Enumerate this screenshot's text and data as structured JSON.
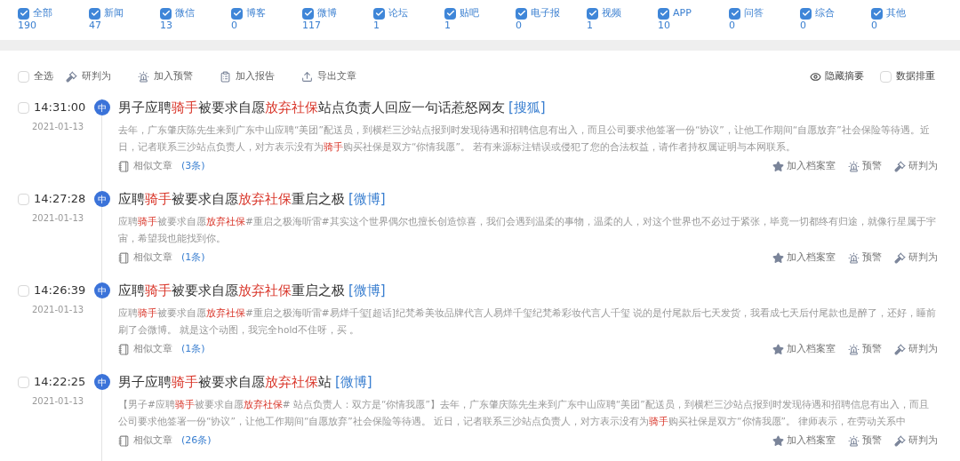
{
  "filters": [
    {
      "label": "全部",
      "count": "190",
      "checked": true
    },
    {
      "label": "新闻",
      "count": "47",
      "checked": true
    },
    {
      "label": "微信",
      "count": "13",
      "checked": true
    },
    {
      "label": "博客",
      "count": "0",
      "checked": true
    },
    {
      "label": "微博",
      "count": "117",
      "checked": true
    },
    {
      "label": "论坛",
      "count": "1",
      "checked": true
    },
    {
      "label": "贴吧",
      "count": "1",
      "checked": true
    },
    {
      "label": "电子报",
      "count": "0",
      "checked": true
    },
    {
      "label": "视频",
      "count": "1",
      "checked": true
    },
    {
      "label": "APP",
      "count": "10",
      "checked": true
    },
    {
      "label": "问答",
      "count": "0",
      "checked": true
    },
    {
      "label": "综合",
      "count": "0",
      "checked": true
    },
    {
      "label": "其他",
      "count": "0",
      "checked": true
    }
  ],
  "toolbar": {
    "select_all": {
      "label": "全选",
      "checked": false
    },
    "actions": [
      {
        "kind": "judge",
        "label": "研判为"
      },
      {
        "kind": "alert",
        "label": "加入预警"
      },
      {
        "kind": "report",
        "label": "加入报告"
      },
      {
        "kind": "export",
        "label": "导出文章"
      }
    ],
    "hide_summary": {
      "label": "隐藏摘要"
    },
    "dedupe": {
      "label": "数据排重",
      "checked": false
    }
  },
  "articles": [
    {
      "checked": false,
      "time": "14:31:00",
      "date": "2021-01-13",
      "badge": "中",
      "title": [
        {
          "text": "男子应聘",
          "highlight": false
        },
        {
          "text": "骑手",
          "highlight": true
        },
        {
          "text": "被要求自愿",
          "highlight": false
        },
        {
          "text": "放弃社保",
          "highlight": true
        },
        {
          "text": "站点负责人回应一句话惹怒网友",
          "highlight": false
        }
      ],
      "source": "[搜狐]",
      "summary": [
        {
          "text": "去年，广东肇庆陈先生来到广东中山应聘“美团”配送员，到横栏三沙站点报到时发现待遇和招聘信息有出入，而且公司要求他签署一份“协议”，让他工作期间“自愿放弃”社会保险等待遇。近日，记者联系三沙站点负责人，对方表示没有为",
          "highlight": false
        },
        {
          "text": "骑手",
          "highlight": true
        },
        {
          "text": "购买社保是双方“你情我愿”。 若有来源标注错误或侵犯了您的合法权益，请作者持权属证明与本网联系。",
          "highlight": false
        }
      ],
      "similar_label": "相似文章",
      "similar_count": "(3条)",
      "actions": [
        {
          "kind": "archive",
          "label": "加入档案室"
        },
        {
          "kind": "alert",
          "label": "预警"
        },
        {
          "kind": "judge",
          "label": "研判为"
        }
      ]
    },
    {
      "checked": false,
      "time": "14:27:28",
      "date": "2021-01-13",
      "badge": "中",
      "title": [
        {
          "text": "应聘",
          "highlight": false
        },
        {
          "text": "骑手",
          "highlight": true
        },
        {
          "text": "被要求自愿",
          "highlight": false
        },
        {
          "text": "放弃社保",
          "highlight": true
        },
        {
          "text": "重启之极",
          "highlight": false
        }
      ],
      "source": "[微博]",
      "summary": [
        {
          "text": "应聘",
          "highlight": false
        },
        {
          "text": "骑手",
          "highlight": true
        },
        {
          "text": "被要求自愿",
          "highlight": false
        },
        {
          "text": "放弃社保",
          "highlight": true
        },
        {
          "text": "#重启之极海听雷#其实这个世界偶尔也擅长创造惊喜，我们会遇到温柔的事物，温柔的人，对这个世界也不必过于紧张，毕竟一切都终有归途，就像行星属于宇宙，希望我也能找到你。",
          "highlight": false
        }
      ],
      "similar_label": "相似文章",
      "similar_count": "(1条)",
      "actions": [
        {
          "kind": "archive",
          "label": "加入档案室"
        },
        {
          "kind": "alert",
          "label": "预警"
        },
        {
          "kind": "judge",
          "label": "研判为"
        }
      ]
    },
    {
      "checked": false,
      "time": "14:26:39",
      "date": "2021-01-13",
      "badge": "中",
      "title": [
        {
          "text": "应聘",
          "highlight": false
        },
        {
          "text": "骑手",
          "highlight": true
        },
        {
          "text": "被要求自愿",
          "highlight": false
        },
        {
          "text": "放弃社保",
          "highlight": true
        },
        {
          "text": "重启之极",
          "highlight": false
        }
      ],
      "source": "[微博]",
      "summary": [
        {
          "text": "应聘",
          "highlight": false
        },
        {
          "text": "骑手",
          "highlight": true
        },
        {
          "text": "被要求自愿",
          "highlight": false
        },
        {
          "text": "放弃社保",
          "highlight": true
        },
        {
          "text": "#重启之极海听雷#易烊千玺[超话]纪梵希美妆品牌代言人易烊千玺纪梵希彩妆代言人千玺 说的是付尾款后七天发货，我看成七天后付尾款也是醉了，还好，睡前刷了会微博。 就是这个动图，我完全hold不住呀，买 。",
          "highlight": false
        }
      ],
      "similar_label": "相似文章",
      "similar_count": "(1条)",
      "actions": [
        {
          "kind": "archive",
          "label": "加入档案室"
        },
        {
          "kind": "alert",
          "label": "预警"
        },
        {
          "kind": "judge",
          "label": "研判为"
        }
      ]
    },
    {
      "checked": false,
      "time": "14:22:25",
      "date": "2021-01-13",
      "badge": "中",
      "title": [
        {
          "text": "男子应聘",
          "highlight": false
        },
        {
          "text": "骑手",
          "highlight": true
        },
        {
          "text": "被要求自愿",
          "highlight": false
        },
        {
          "text": "放弃社保",
          "highlight": true
        },
        {
          "text": "站",
          "highlight": false
        }
      ],
      "source": "[微博]",
      "summary": [
        {
          "text": "【男子#应聘",
          "highlight": false
        },
        {
          "text": "骑手",
          "highlight": true
        },
        {
          "text": "被要求自愿",
          "highlight": false
        },
        {
          "text": "放弃社保",
          "highlight": true
        },
        {
          "text": "# 站点负责人：双方是“你情我愿”】去年，广东肇庆陈先生来到广东中山应聘“美团”配送员，到横栏三沙站点报到时发现待遇和招聘信息有出入，而且公司要求他签署一份“协议”，让他工作期间“自愿放弃”社会保险等待遇。 近日，记者联系三沙站点负责人，对方表示没有为",
          "highlight": false
        },
        {
          "text": "骑手",
          "highlight": true
        },
        {
          "text": "购买社保是双方“你情我愿”。 律师表示，在劳动关系中",
          "highlight": false
        }
      ],
      "similar_label": "相似文章",
      "similar_count": "(26条)",
      "actions": [
        {
          "kind": "archive",
          "label": "加入档案室"
        },
        {
          "kind": "alert",
          "label": "预警"
        },
        {
          "kind": "judge",
          "label": "研判为"
        }
      ]
    }
  ]
}
